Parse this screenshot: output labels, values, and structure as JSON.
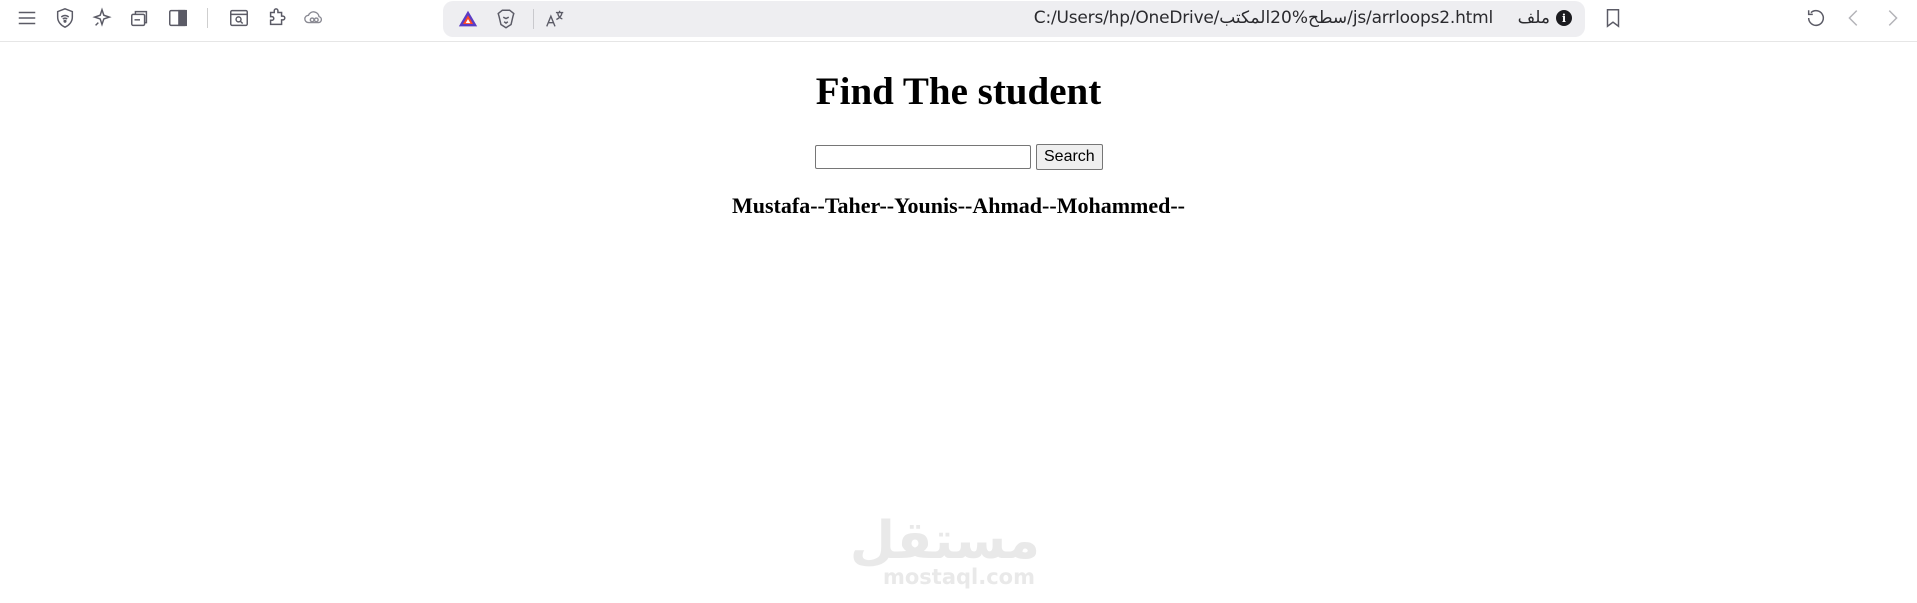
{
  "browser": {
    "address_bar": {
      "url": "C:/Users/hp/OneDrive/سطح%20المكتب/js/arrloops2.html",
      "scheme_label": "ملف"
    }
  },
  "page": {
    "title": "Find The student",
    "search": {
      "value": "",
      "button_label": "Search"
    },
    "student_list": "Mustafa--Taher--Younis--Ahmad--Mohammed--"
  },
  "watermark": {
    "arabic": "مستقل",
    "latin": "mostaql.com"
  },
  "colors": {
    "toolbar_bg": "#ffffff",
    "addressbar_bg": "#eeeef1",
    "icon_gray": "#5b5b66",
    "watermark": "#e9e9e9"
  }
}
